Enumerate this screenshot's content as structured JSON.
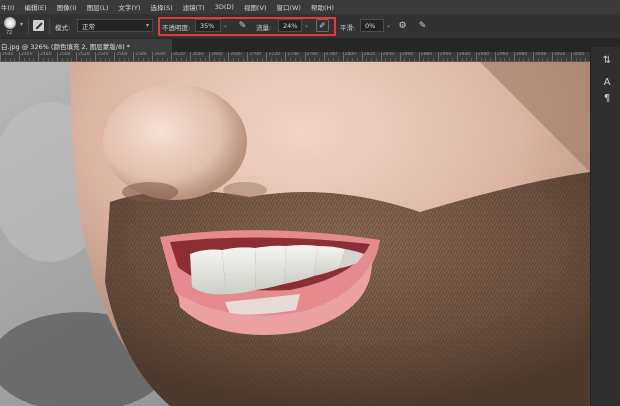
{
  "menu": [
    "牛(I)",
    "编辑(E)",
    "图像(I)",
    "图层(L)",
    "文字(Y)",
    "选择(S)",
    "滤镜(T)",
    "3D(D)",
    "视图(V)",
    "窗口(W)",
    "帮助(H)"
  ],
  "options": {
    "brush_size": "72",
    "mode_label": "模式:",
    "mode_value": "正常",
    "opacity_label": "不透明度:",
    "opacity_value": "35%",
    "flow_label": "流量:",
    "flow_value": "24%",
    "smoothing_label": "平滑:",
    "smoothing_value": "0%"
  },
  "document_tab": "白.jpg @ 326% (颜色填充 2, 图层蒙版/8) *",
  "ruler_ticks": [
    "2640",
    "2460",
    "2480",
    "2500",
    "2520",
    "2540",
    "2560",
    "2580",
    "2600",
    "2620",
    "2640",
    "2660",
    "2680",
    "2700",
    "2720",
    "2740",
    "2760",
    "2780",
    "2800",
    "2820",
    "2840",
    "2860",
    "2880",
    "2900",
    "2920",
    "2940",
    "2960",
    "2980",
    "3000",
    "3020",
    "3040"
  ],
  "colors": {
    "highlight": "#e23a3a",
    "ui_dark": "#323232"
  },
  "icons": {
    "brush_tip": "soft-round-brush-icon",
    "toggle_panel": "brush-settings-icon",
    "opacity_pressure": "pen-pressure-icon",
    "airbrush": "airbrush-icon",
    "settings": "gear-icon",
    "size_pressure": "size-pressure-icon"
  }
}
